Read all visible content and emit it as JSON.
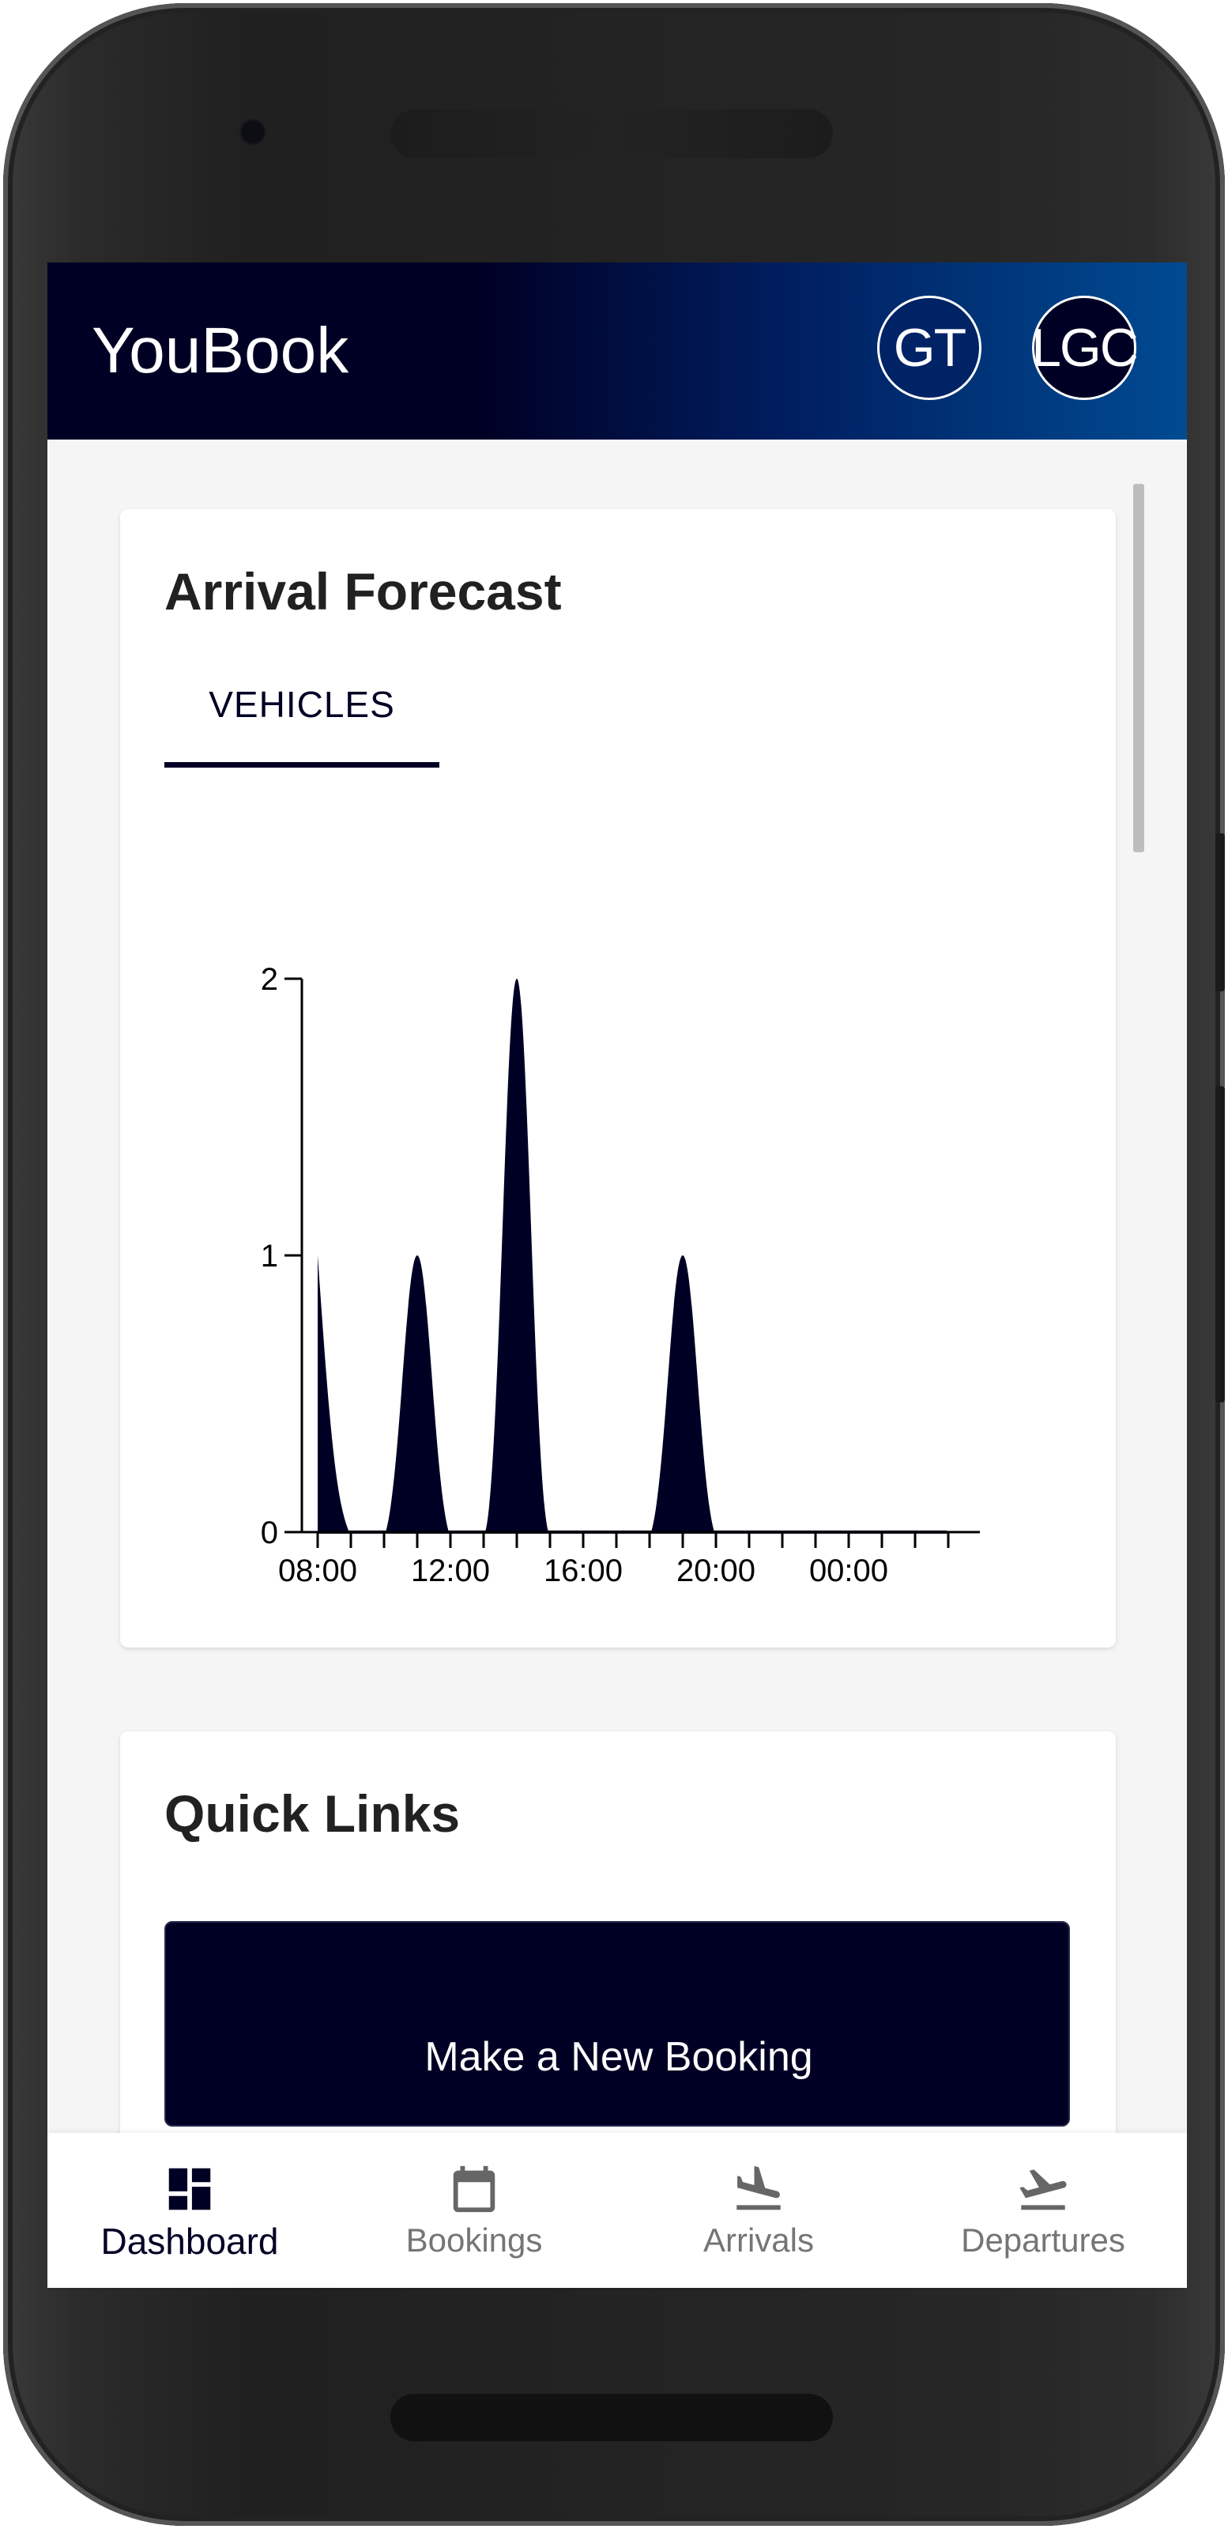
{
  "app": {
    "title": "YouBook"
  },
  "header": {
    "avatars": [
      "GT",
      "LGC"
    ]
  },
  "arrival_forecast": {
    "title": "Arrival Forecast",
    "tab": "VEHICLES"
  },
  "chart_data": {
    "type": "area",
    "title": "",
    "xlabel": "",
    "ylabel": "",
    "x": [
      "08:00",
      "09:00",
      "10:00",
      "11:00",
      "12:00",
      "13:00",
      "14:00",
      "15:00",
      "16:00",
      "17:00",
      "18:00",
      "19:00",
      "20:00",
      "21:00",
      "22:00",
      "23:00",
      "00:00",
      "01:00",
      "02:00"
    ],
    "series": [
      {
        "values": [
          1,
          0,
          0,
          1,
          0,
          0,
          2,
          0,
          0,
          0,
          0,
          1,
          0,
          0,
          0,
          0,
          0,
          0,
          0
        ]
      }
    ],
    "x_tick_labels": [
      "08:00",
      "12:00",
      "16:00",
      "20:00",
      "00:00"
    ],
    "y_ticks": [
      0,
      1,
      2
    ],
    "ylim": [
      0,
      2
    ],
    "grid": false,
    "color": "#000025"
  },
  "quick_links": {
    "title": "Quick Links",
    "new_booking": "Make a New Booking"
  },
  "nav": {
    "items": [
      {
        "label": "Dashboard",
        "icon": "dashboard-icon",
        "active": true
      },
      {
        "label": "Bookings",
        "icon": "calendar-icon",
        "active": false
      },
      {
        "label": "Arrivals",
        "icon": "flight-land-icon",
        "active": false
      },
      {
        "label": "Departures",
        "icon": "flight-takeoff-icon",
        "active": false
      }
    ]
  },
  "colors": {
    "primary": "#000025",
    "accent": "#004b92"
  }
}
